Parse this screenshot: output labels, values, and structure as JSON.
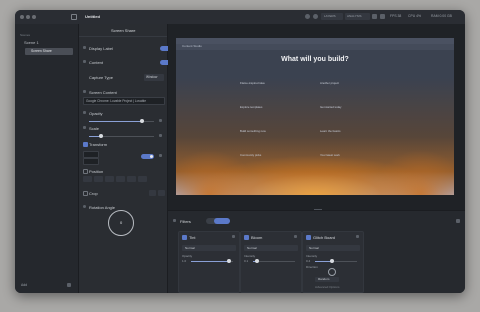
{
  "window": {
    "title": "Untitled"
  },
  "titlebar": {
    "tabs": [
      "LAYERS",
      "ANALYSIS"
    ],
    "fps": "FPS 38",
    "cpu": "CPU 4%",
    "ram": "RAM 0.00 GB",
    "zoom": "100"
  },
  "sidebar": {
    "section_label": "Scenes",
    "scene_name": "Scene 1",
    "source_item": "Screen Share",
    "add_label": "Add"
  },
  "properties": {
    "title": "Screen Share",
    "display_label": "Display Label",
    "content_label": "Content",
    "capture_type_label": "Capture Type",
    "capture_type_value": "Window",
    "screen_content_label": "Screen Content",
    "screen_content_value": "Google Chrome: Lovable Project | Lovable",
    "opacity_label": "Opacity",
    "opacity_level": 0.82,
    "scale_label": "Scale",
    "scale_level": 0.18,
    "transform_label": "Transform",
    "position_label": "Position",
    "crop_label": "Crop",
    "rotation_label": "Rotation Angle",
    "rotation_value": "0"
  },
  "preview": {
    "browser_label": "Content Studio",
    "headline": "What will you build?",
    "card_lines": [
      "Flame-inspired idea",
      "Another project",
      "Explore templates",
      "Get started today",
      "Build something new",
      "Learn the basics",
      "Community picks",
      "Your latest work"
    ]
  },
  "filters": {
    "title": "Filters",
    "cards": [
      {
        "name": "Tint",
        "mode": "Normal",
        "param_label": "Opacity",
        "param_value": "1.0",
        "level": 0.9
      },
      {
        "name": "Bloom",
        "mode": "Normal",
        "param_label": "Intensity",
        "param_value": "0.1",
        "level": 0.1
      },
      {
        "name": "Glitch Board",
        "mode": "Normal",
        "param_label": "Intensity",
        "param_value": "0.4",
        "extra_label": "Direction",
        "extra_select": "Random",
        "footer": "Advanced Options",
        "level": 0.4
      }
    ]
  },
  "colors": {
    "accent": "#5b79c9",
    "window_bg": "#23262b",
    "desktop": "#a9a8a6",
    "fire_orange": "#d27a1e"
  }
}
